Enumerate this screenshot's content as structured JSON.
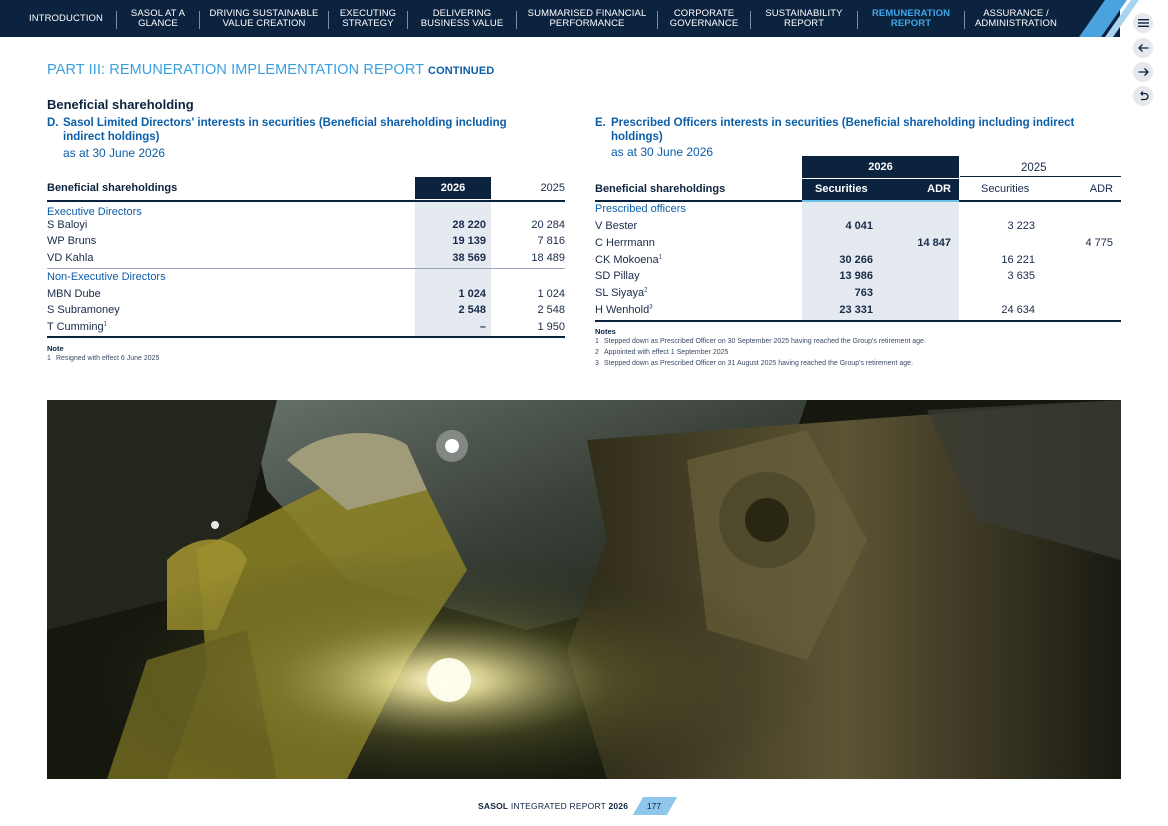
{
  "nav": {
    "items": [
      {
        "label": "INTRODUCTION",
        "active": false
      },
      {
        "label": "SASOL AT A GLANCE",
        "active": false
      },
      {
        "label": "DRIVING SUSTAINABLE VALUE CREATION",
        "active": false
      },
      {
        "label": "EXECUTING STRATEGY",
        "active": false
      },
      {
        "label": "DELIVERING BUSINESS VALUE",
        "active": false
      },
      {
        "label": "SUMMARISED FINANCIAL PERFORMANCE",
        "active": false
      },
      {
        "label": "CORPORATE GOVERNANCE",
        "active": false
      },
      {
        "label": "SUSTAINABILITY REPORT",
        "active": false
      },
      {
        "label": "REMUNERATION REPORT",
        "active": true
      },
      {
        "label": "ASSURANCE / ADMINISTRATION",
        "active": false
      }
    ]
  },
  "side_buttons": {
    "menu_icon": "hamburger-menu-icon",
    "back_icon": "arrow-left-icon",
    "forward_icon": "arrow-right-icon",
    "return_icon": "return-arrow-icon"
  },
  "colors": {
    "navy": "#0c2340",
    "accent": "#3a9fe0",
    "shade": "#e4eaf0"
  },
  "page": {
    "part_title": "PART III: REMUNERATION IMPLEMENTATION REPORT",
    "part_title_suffix": "CONTINUED",
    "section_heading": "Beneficial shareholding"
  },
  "table_d": {
    "tag": "D.",
    "title_line1": "Sasol Limited Directors' interests in securities (Beneficial shareholding including",
    "title_line2": "indirect holdings)",
    "date": "as at 30 June 2026",
    "col_label": "Beneficial shareholdings",
    "col_2026": "2026",
    "col_2025": "2025",
    "groups": [
      {
        "name": "Executive Directors",
        "rows": [
          {
            "name": "S Baloyi",
            "v2026": "28 220",
            "v2025": "20 284"
          },
          {
            "name": "WP Bruns",
            "v2026": "19 139",
            "v2025": "7 816"
          },
          {
            "name": "VD Kahla",
            "v2026": "38 569",
            "v2025": "18 489"
          }
        ]
      },
      {
        "name": "Non-Executive Directors",
        "rows": [
          {
            "name": "MBN Dube",
            "v2026": "1 024",
            "v2025": "1 024"
          },
          {
            "name": "S Subramoney",
            "v2026": "2 548",
            "v2025": "2 548"
          },
          {
            "name": "T Cumming",
            "sup": "1",
            "v2026": "–",
            "v2025": "1 950"
          }
        ]
      }
    ],
    "note_heading": "Note",
    "notes": [
      {
        "num": "1",
        "text": "Resigned with effect 6 June 2025"
      }
    ]
  },
  "table_e": {
    "tag": "E.",
    "title_line1": "Prescribed Officers interests in securities (Beneficial shareholding including indirect",
    "title_line2": "holdings)",
    "date": "as at 30 June 2026",
    "year_2026": "2026",
    "year_2025": "2025",
    "col_label": "Beneficial shareholdings",
    "col_securities": "Securities",
    "col_adr": "ADR",
    "group_name": "Prescribed officers",
    "rows": [
      {
        "name": "V Bester",
        "sup": "",
        "sec2026": "4 041",
        "adr2026": "",
        "sec2025": "3 223",
        "adr2025": ""
      },
      {
        "name": "C Herrmann",
        "sup": "",
        "sec2026": "",
        "adr2026": "14 847",
        "sec2025": "",
        "adr2025": "4 775"
      },
      {
        "name": "CK Mokoena",
        "sup": "1",
        "sec2026": "30 266",
        "adr2026": "",
        "sec2025": "16 221",
        "adr2025": ""
      },
      {
        "name": "SD Pillay",
        "sup": "",
        "sec2026": "13 986",
        "adr2026": "",
        "sec2025": "3 635",
        "adr2025": ""
      },
      {
        "name": "SL Siyaya",
        "sup": "2",
        "sec2026": "763",
        "adr2026": "",
        "sec2025": "",
        "adr2025": ""
      },
      {
        "name": "H Wenhold",
        "sup": "3",
        "sec2026": "23 331",
        "adr2026": "",
        "sec2025": "24 634",
        "adr2025": ""
      }
    ],
    "note_heading": "Notes",
    "notes": [
      {
        "num": "1",
        "text": "Stepped down as Prescribed Officer on 30 September 2025 having reached the Group's retirement age."
      },
      {
        "num": "2",
        "text": "Appointed with effect 1 September 2025"
      },
      {
        "num": "3",
        "text": "Stepped down as Prescribed Officer on 31 August 2025 having reached the Group's retirement age."
      }
    ]
  },
  "footer": {
    "brand": "SASOL",
    "report": "INTEGRATED REPORT",
    "year": "2026",
    "page_number": "177"
  }
}
